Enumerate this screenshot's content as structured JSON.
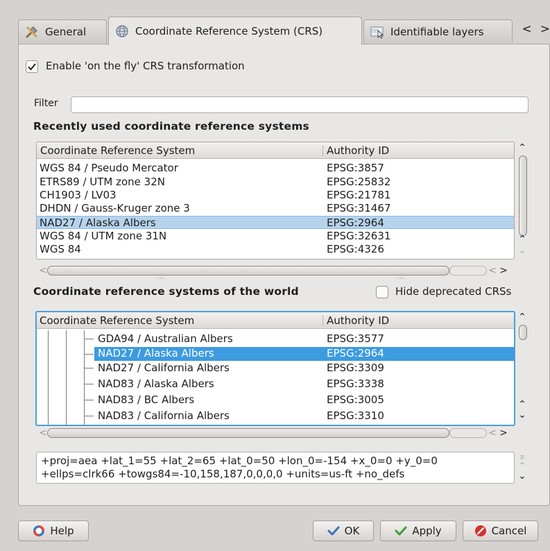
{
  "tabs": [
    {
      "label": "General",
      "icon": "tools-icon",
      "active": false
    },
    {
      "label": "Coordinate Reference System (CRS)",
      "icon": "globe-icon",
      "active": true
    },
    {
      "label": "Identifiable layers",
      "icon": "identify-layers-icon",
      "active": false
    }
  ],
  "tab_nav": {
    "prev": "<",
    "next": ">"
  },
  "otf": {
    "label": "Enable 'on the fly' CRS transformation",
    "checked": true
  },
  "filter": {
    "label": "Filter",
    "value": "",
    "placeholder": ""
  },
  "recent": {
    "title": "Recently used coordinate reference systems",
    "columns": [
      "Coordinate Reference System",
      "Authority ID"
    ],
    "rows": [
      {
        "name": "WGS 84 / Pseudo Mercator",
        "id": "EPSG:3857"
      },
      {
        "name": "ETRS89 / UTM zone 32N",
        "id": "EPSG:25832"
      },
      {
        "name": "CH1903 / LV03",
        "id": "EPSG:21781"
      },
      {
        "name": "DHDN / Gauss-Kruger zone 3",
        "id": "EPSG:31467"
      },
      {
        "name": "NAD27 / Alaska Albers",
        "id": "EPSG:2964",
        "selected": true
      },
      {
        "name": "WGS 84 / UTM zone 31N",
        "id": "EPSG:32631"
      },
      {
        "name": "WGS 84",
        "id": "EPSG:4326"
      }
    ]
  },
  "world": {
    "title": "Coordinate reference systems of the world",
    "hide_deprecated": {
      "label": "Hide deprecated CRSs",
      "checked": false
    },
    "columns": [
      "Coordinate Reference System",
      "Authority ID"
    ],
    "rows": [
      {
        "name": "GDA94 / Australian Albers",
        "id": "EPSG:3577"
      },
      {
        "name": "NAD27 / Alaska Albers",
        "id": "EPSG:2964",
        "selected": true
      },
      {
        "name": "NAD27 / California Albers",
        "id": "EPSG:3309"
      },
      {
        "name": "NAD83 / Alaska Albers",
        "id": "EPSG:3338"
      },
      {
        "name": "NAD83 / BC Albers",
        "id": "EPSG:3005"
      },
      {
        "name": "NAD83 / California Albers",
        "id": "EPSG:3310"
      }
    ]
  },
  "proj_string": {
    "line1": "+proj=aea +lat_1=55 +lat_2=65 +lat_0=50 +lon_0=-154 +x_0=0 +y_0=0",
    "line2": "+ellps=clrk66 +towgs84=-10,158,187,0,0,0,0 +units=us-ft +no_defs"
  },
  "buttons": {
    "help": "Help",
    "ok": "OK",
    "apply": "Apply",
    "cancel": "Cancel"
  },
  "colors": {
    "selection_focused": "#3d9be0",
    "selection_unfocused": "#b6d3ec",
    "focus_border": "#4a9fd9",
    "cancel_icon": "#d0312d",
    "ok_check": "#3c6fc0",
    "apply_check": "#3e9a36"
  }
}
